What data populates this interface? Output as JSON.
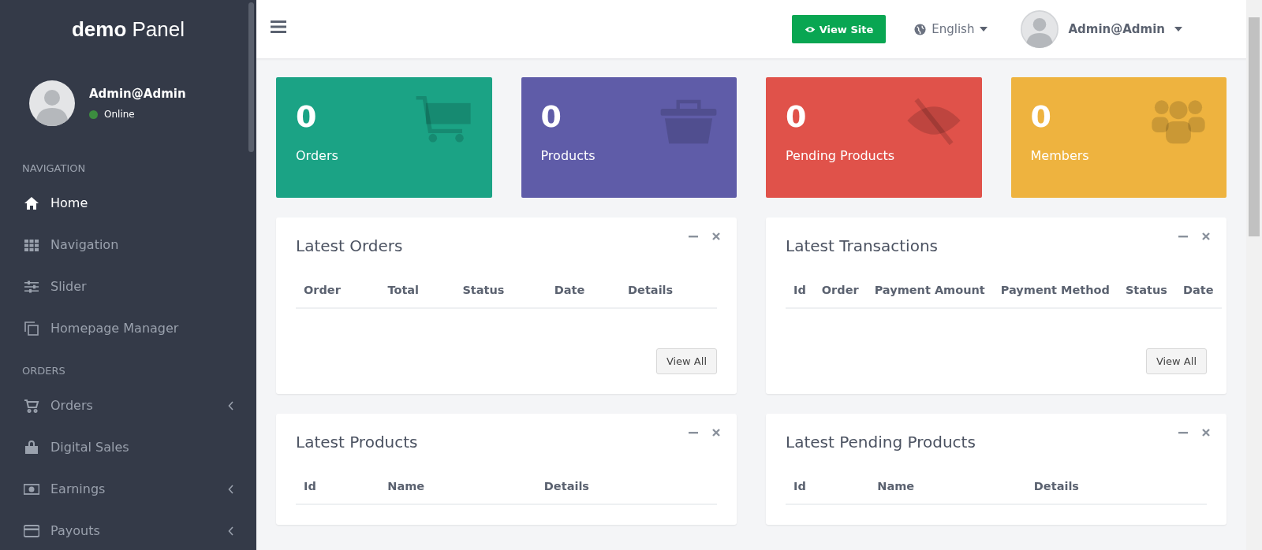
{
  "brand": {
    "bold": "demo",
    "rest": "Panel"
  },
  "user": {
    "name": "Admin@Admin",
    "status": "Online"
  },
  "sidebar": {
    "sections": [
      {
        "heading": "NAVIGATION",
        "items": [
          {
            "label": "Home",
            "kind": "home",
            "selected": true,
            "has_submenu": false
          },
          {
            "label": "Navigation",
            "kind": "grid",
            "selected": false,
            "has_submenu": false
          },
          {
            "label": "Slider",
            "kind": "sliders",
            "selected": false,
            "has_submenu": false
          },
          {
            "label": "Homepage Manager",
            "kind": "copy",
            "selected": false,
            "has_submenu": false
          }
        ]
      },
      {
        "heading": "ORDERS",
        "items": [
          {
            "label": "Orders",
            "kind": "cart",
            "selected": false,
            "has_submenu": true
          },
          {
            "label": "Digital Sales",
            "kind": "bag",
            "selected": false,
            "has_submenu": false
          },
          {
            "label": "Earnings",
            "kind": "money",
            "selected": false,
            "has_submenu": true
          },
          {
            "label": "Payouts",
            "kind": "card",
            "selected": false,
            "has_submenu": true
          }
        ]
      }
    ]
  },
  "topbar": {
    "view_site": "View Site",
    "language": "English",
    "user": "Admin@Admin"
  },
  "stats": [
    {
      "value": "0",
      "label": "Orders",
      "color": "#1ba385",
      "kind": "cart"
    },
    {
      "value": "0",
      "label": "Products",
      "color": "#5f5ca8",
      "kind": "basket"
    },
    {
      "value": "0",
      "label": "Pending Products",
      "color": "#e0524a",
      "kind": "eye-slash"
    },
    {
      "value": "0",
      "label": "Members",
      "color": "#eeb33f",
      "kind": "users"
    }
  ],
  "panels": [
    {
      "title": "Latest Orders",
      "columns": [
        "Order",
        "Total",
        "Status",
        "Date",
        "Details"
      ],
      "button": "View All"
    },
    {
      "title": "Latest Transactions",
      "columns": [
        "Id",
        "Order",
        "Payment Amount",
        "Payment Method",
        "Status",
        "Date"
      ],
      "button": "View All"
    },
    {
      "title": "Latest Products",
      "columns": [
        "Id",
        "Name",
        "Details"
      ]
    },
    {
      "title": "Latest Pending Products",
      "columns": [
        "Id",
        "Name",
        "Details"
      ]
    }
  ]
}
